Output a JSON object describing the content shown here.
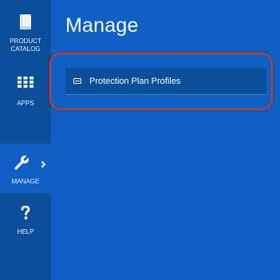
{
  "sidebar": {
    "items": [
      {
        "label": "PRODUCT CATALOG",
        "icon": "book-icon"
      },
      {
        "label": "APPS",
        "icon": "grid-icon"
      },
      {
        "label": "MANAGE",
        "icon": "wrench-icon",
        "active": true
      },
      {
        "label": "HELP",
        "icon": "question-icon"
      }
    ]
  },
  "main": {
    "title": "Manage",
    "menu": [
      {
        "label": "Protection Plan Profiles",
        "icon": "card-icon"
      }
    ]
  },
  "colors": {
    "background": "#0f5fc4",
    "sidebar": "#0b4e99",
    "highlight": "#c8392f"
  }
}
